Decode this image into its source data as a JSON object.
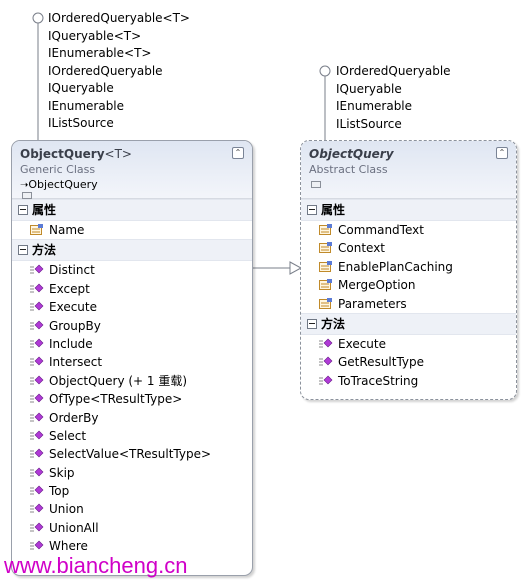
{
  "left_interfaces": [
    "IOrderedQueryable<T>",
    "IQueryable<T>",
    "IEnumerable<T>",
    "IOrderedQueryable",
    "IQueryable",
    "IEnumerable",
    "IListSource"
  ],
  "right_interfaces": [
    "IOrderedQueryable",
    "IQueryable",
    "IEnumerable",
    "IListSource"
  ],
  "left_class": {
    "name": "ObjectQuery",
    "generic": "<T>",
    "kind": "Generic Class",
    "base": "ObjectQuery",
    "collapse_glyph": "⌃",
    "properties_header": "属性",
    "properties": [
      "Name"
    ],
    "methods_header": "方法",
    "methods": [
      "Distinct",
      "Except",
      "Execute",
      "GroupBy",
      "Include",
      "Intersect",
      "ObjectQuery (+ 1 重载)",
      "OfType<TResultType>",
      "OrderBy",
      "Select",
      "SelectValue<TResultType>",
      "Skip",
      "Top",
      "Union",
      "UnionAll",
      "Where"
    ]
  },
  "right_class": {
    "name": "ObjectQuery",
    "kind": "Abstract Class",
    "collapse_glyph": "⌃",
    "properties_header": "属性",
    "properties": [
      "CommandText",
      "Context",
      "EnablePlanCaching",
      "MergeOption",
      "Parameters"
    ],
    "methods_header": "方法",
    "methods": [
      "Execute",
      "GetResultType",
      "ToTraceString"
    ]
  },
  "watermark": "www.biancheng.cn",
  "colors": {
    "watermark": "#d000c8",
    "method_icon": "#b03ad6",
    "property_icon": "#d9a33a"
  }
}
